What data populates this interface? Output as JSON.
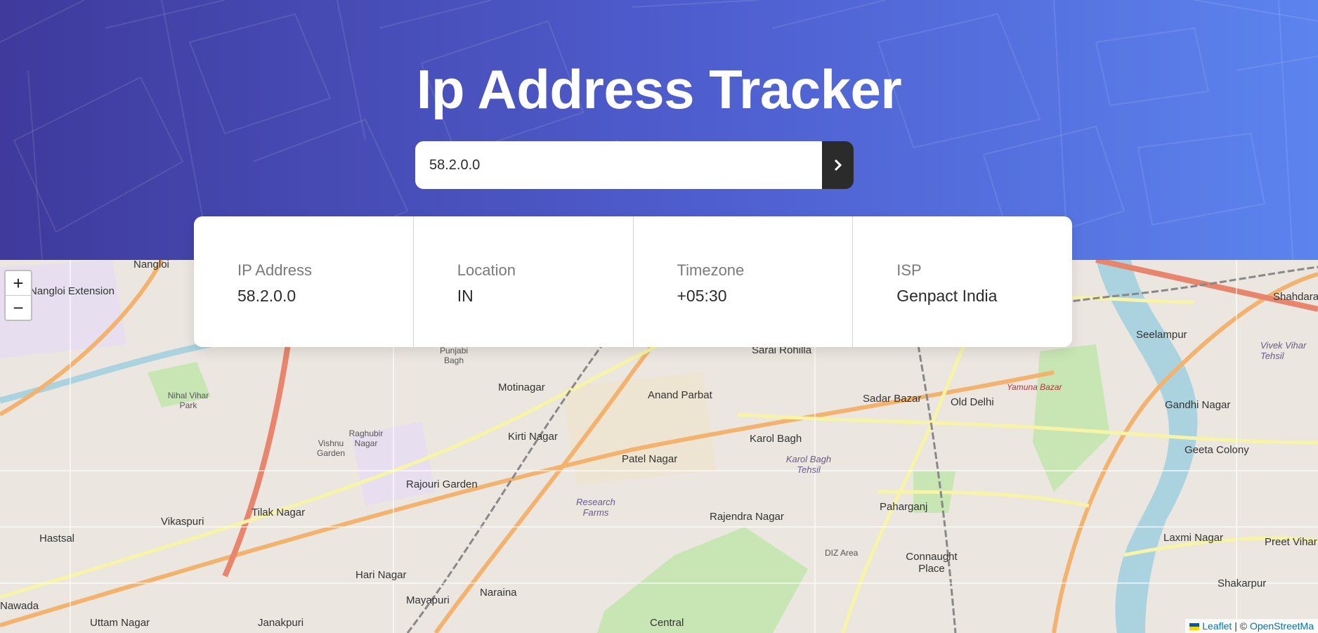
{
  "header": {
    "title": "Ip Address Tracker",
    "search_value": "58.2.0.0",
    "submit_icon": "chevron-right-icon"
  },
  "info": [
    {
      "label": "IP Address",
      "value": "58.2.0.0"
    },
    {
      "label": "Location",
      "value": "IN"
    },
    {
      "label": "Timezone",
      "value": "+05:30"
    },
    {
      "label": "ISP",
      "value": "Genpact India"
    }
  ],
  "map": {
    "zoom_in": "+",
    "zoom_out": "−",
    "labels": [
      "Nangloi",
      "Nangloi Extension",
      "Sarai Rohilla",
      "Seelampur",
      "Shahdara",
      "Punjabi Bagh",
      "Motinagar",
      "Anand Parbat",
      "Sadar Bazar",
      "Old Delhi",
      "Yamuna Bazar",
      "Gandhi Nagar",
      "Vivek Vihar Tehsil",
      "Nihal Vihar Park",
      "Raghubir Nagar",
      "Vishnu Garden",
      "Kirti Nagar",
      "Karol Bagh",
      "Karol Bagh Tehsil",
      "Patel Nagar",
      "Rajouri Garden",
      "Geeta Colony",
      "Tilak Nagar",
      "Vikaspuri",
      "Rajendra Nagar",
      "Paharganj",
      "Hastsal",
      "Research Farms",
      "DIZ Area",
      "Laxmi Nagar",
      "Preet Vihar",
      "Connaught Place",
      "Hari Nagar",
      "Nawada",
      "Mayapuri",
      "Naraina",
      "Shakarpur",
      "Uttam Nagar",
      "Janakpuri",
      "Central"
    ],
    "attribution_leaflet": "Leaflet",
    "attribution_sep": " | © ",
    "attribution_osm": "OpenStreetMa"
  },
  "colors": {
    "header_start": "#3f3a9c",
    "header_end": "#5c84ee",
    "button_bg": "#2b2b2b"
  }
}
